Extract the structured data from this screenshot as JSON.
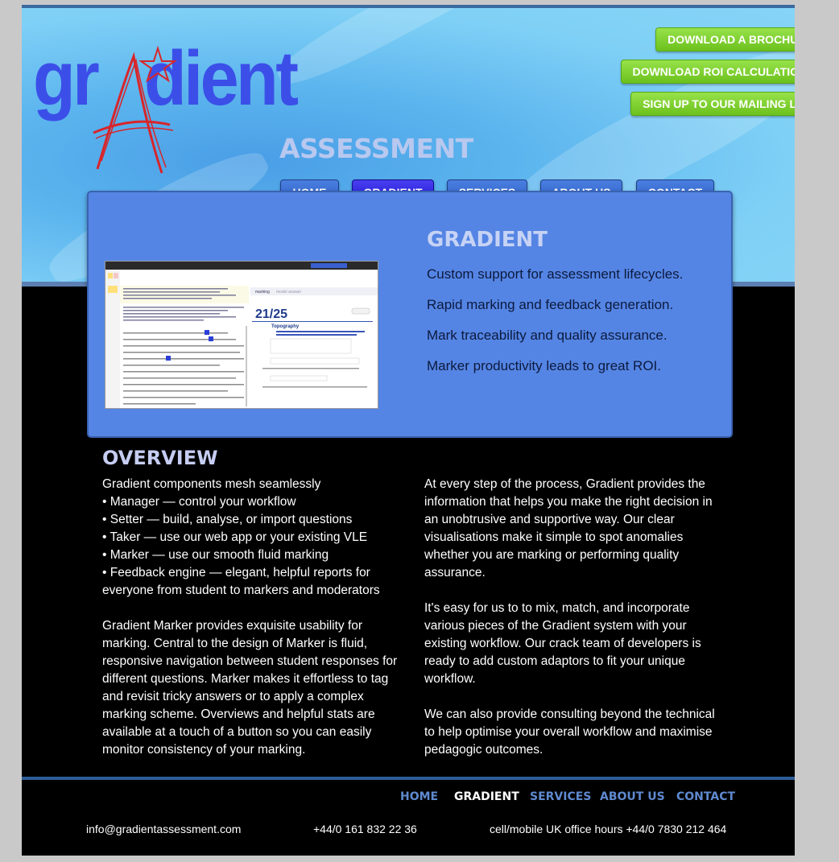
{
  "logo": {
    "main_text": "gradient",
    "sub_text": "ASSESSMENT"
  },
  "cta": {
    "brochure": "DOWNLOAD A BROCHURE",
    "roi": "DOWNLOAD ROI CALCULATIONS",
    "mailing": "SIGN UP TO OUR MAILING LIST"
  },
  "nav": {
    "home": "HOME",
    "gradient": "GRADIENT",
    "services": "SERVICES",
    "about": "ABOUT US",
    "contact": "CONTACT"
  },
  "hero": {
    "title": "GRADIENT",
    "lines": [
      "Custom support for assessment lifecycles.",
      "Rapid marking and feedback generation.",
      "Mark traceability and quality assurance.",
      "Marker productivity leads to great ROI."
    ]
  },
  "overview": {
    "title": "OVERVIEW",
    "left_list": [
      "Gradient components mesh seamlessly",
      "• Manager — control your workflow",
      "• Setter — build, analyse, or import questions",
      "• Taker — use our web app or your existing VLE",
      "• Marker — use our smooth fluid marking",
      "• Feedback engine — elegant, helpful reports for everyone from student to markers and moderators"
    ],
    "left_para": "Gradient Marker provides exquisite usability for marking. Central to the design of Marker is fluid, responsive navigation between student responses for different questions. Marker makes it effortless to tag and revisit tricky answers or to apply a complex marking scheme. Overviews and helpful stats are available at a touch of a button so you can easily monitor consistency of your marking.",
    "right_paras": [
      "At every step of the process, Gradient provides the information that helps you make the right decision in an unobtrusive and supportive way. Our clear visualisations make it simple to spot anomalies whether you are marking or performing quality assurance.",
      "It's easy for us to to mix, match, and incorporate various pieces of the Gradient system with your existing workflow. Our crack team of developers is ready to add custom adaptors to fit your unique workflow.",
      "We can also provide consulting beyond the technical to help optimise your overall workflow and maximise pedagogic outcomes."
    ]
  },
  "footer": {
    "nav": {
      "home": "HOME",
      "gradient": "GRADIENT",
      "services": "SERVICES",
      "about": "ABOUT US",
      "contact": "CONTACT"
    },
    "email": "info@gradientassessment.com",
    "phone": "+44/0 161 832 22 36",
    "mobile": "cell/mobile UK office hours +44/0 7830 212 464"
  },
  "screenshot": {
    "score": "21/25",
    "section_title": "Topography",
    "tab_marking": "marking",
    "tab_preview": "model answer"
  },
  "colors": {
    "accent": "#5585e4",
    "nav": "#2d5fc6",
    "nav_active": "#1d17d6",
    "cta_green": "#7ccf2c",
    "logo_blue": "#3b4fe8",
    "star_red": "#d8252a"
  }
}
